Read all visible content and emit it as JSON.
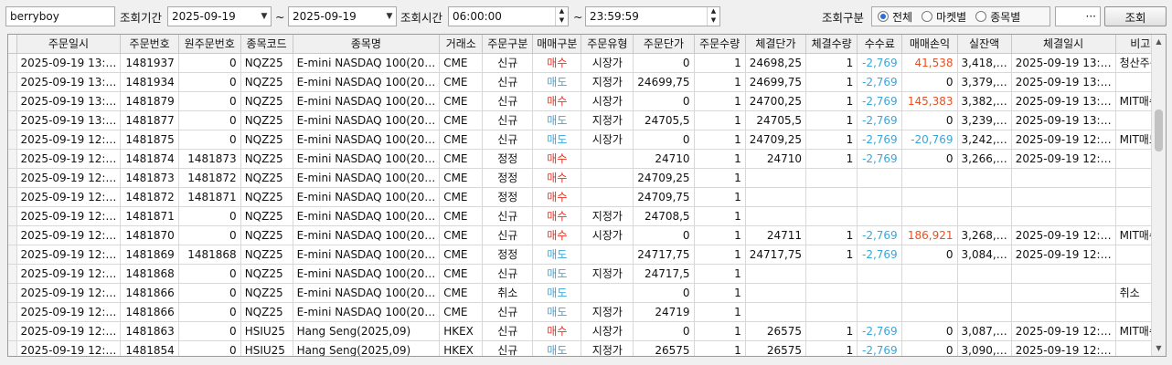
{
  "toolbar": {
    "account": "berryboy",
    "period_label": "조회기간",
    "date_from": "2025-09-19",
    "tilde": "~",
    "date_to": "2025-09-19",
    "time_label": "조회시간",
    "time_from": "06:00:00",
    "time_to": "23:59:59",
    "mode_label": "조회구분",
    "modes": [
      "전체",
      "마켓별",
      "종목별"
    ],
    "selected_mode": "전체",
    "extra_field": "",
    "ellipsis": "···",
    "search_label": "조회"
  },
  "columns": [
    "주문일시",
    "주문번호",
    "원주문번호",
    "종목코드",
    "종목명",
    "거래소",
    "주문구분",
    "매매구분",
    "주문유형",
    "주문단가",
    "주문수량",
    "체결단가",
    "체결수량",
    "수수료",
    "매매손익",
    "실잔액",
    "체결일시",
    "비고"
  ],
  "rows": [
    [
      "2025-09-19 13:…",
      "1481937",
      "0",
      "NQZ25",
      "E-mini NASDAQ 100(20…",
      "CME",
      "신규",
      "매수",
      "시장가",
      "0",
      "1",
      "24698,25",
      "1",
      "-2,769",
      "41,538",
      "3,418,…",
      "2025-09-19 13:…",
      "청산주문"
    ],
    [
      "2025-09-19 13:…",
      "1481934",
      "0",
      "NQZ25",
      "E-mini NASDAQ 100(20…",
      "CME",
      "신규",
      "매도",
      "지정가",
      "24699,75",
      "1",
      "24699,75",
      "1",
      "-2,769",
      "0",
      "3,379,…",
      "2025-09-19 13:…",
      ""
    ],
    [
      "2025-09-19 13:…",
      "1481879",
      "0",
      "NQZ25",
      "E-mini NASDAQ 100(20…",
      "CME",
      "신규",
      "매수",
      "시장가",
      "0",
      "1",
      "24700,25",
      "1",
      "-2,769",
      "145,383",
      "3,382,…",
      "2025-09-19 13:…",
      "MIT매수"
    ],
    [
      "2025-09-19 13:…",
      "1481877",
      "0",
      "NQZ25",
      "E-mini NASDAQ 100(20…",
      "CME",
      "신규",
      "매도",
      "지정가",
      "24705,5",
      "1",
      "24705,5",
      "1",
      "-2,769",
      "0",
      "3,239,…",
      "2025-09-19 13:…",
      ""
    ],
    [
      "2025-09-19 12:…",
      "1481875",
      "0",
      "NQZ25",
      "E-mini NASDAQ 100(20…",
      "CME",
      "신규",
      "매도",
      "시장가",
      "0",
      "1",
      "24709,25",
      "1",
      "-2,769",
      "-20,769",
      "3,242,…",
      "2025-09-19 12:…",
      "MIT매도"
    ],
    [
      "2025-09-19 12:…",
      "1481874",
      "1481873",
      "NQZ25",
      "E-mini NASDAQ 100(20…",
      "CME",
      "정정",
      "매수",
      "",
      "24710",
      "1",
      "24710",
      "1",
      "-2,769",
      "0",
      "3,266,…",
      "2025-09-19 12:…",
      ""
    ],
    [
      "2025-09-19 12:…",
      "1481873",
      "1481872",
      "NQZ25",
      "E-mini NASDAQ 100(20…",
      "CME",
      "정정",
      "매수",
      "",
      "24709,25",
      "1",
      "",
      "",
      "",
      "",
      "",
      "",
      ""
    ],
    [
      "2025-09-19 12:…",
      "1481872",
      "1481871",
      "NQZ25",
      "E-mini NASDAQ 100(20…",
      "CME",
      "정정",
      "매수",
      "",
      "24709,75",
      "1",
      "",
      "",
      "",
      "",
      "",
      "",
      ""
    ],
    [
      "2025-09-19 12:…",
      "1481871",
      "0",
      "NQZ25",
      "E-mini NASDAQ 100(20…",
      "CME",
      "신규",
      "매수",
      "지정가",
      "24708,5",
      "1",
      "",
      "",
      "",
      "",
      "",
      "",
      ""
    ],
    [
      "2025-09-19 12:…",
      "1481870",
      "0",
      "NQZ25",
      "E-mini NASDAQ 100(20…",
      "CME",
      "신규",
      "매수",
      "시장가",
      "0",
      "1",
      "24711",
      "1",
      "-2,769",
      "186,921",
      "3,268,…",
      "2025-09-19 12:…",
      "MIT매수"
    ],
    [
      "2025-09-19 12:…",
      "1481869",
      "1481868",
      "NQZ25",
      "E-mini NASDAQ 100(20…",
      "CME",
      "정정",
      "매도",
      "",
      "24717,75",
      "1",
      "24717,75",
      "1",
      "-2,769",
      "0",
      "3,084,…",
      "2025-09-19 12:…",
      ""
    ],
    [
      "2025-09-19 12:…",
      "1481868",
      "0",
      "NQZ25",
      "E-mini NASDAQ 100(20…",
      "CME",
      "신규",
      "매도",
      "지정가",
      "24717,5",
      "1",
      "",
      "",
      "",
      "",
      "",
      "",
      ""
    ],
    [
      "2025-09-19 12:…",
      "1481866",
      "0",
      "NQZ25",
      "E-mini NASDAQ 100(20…",
      "CME",
      "취소",
      "매도",
      "",
      "0",
      "1",
      "",
      "",
      "",
      "",
      "",
      "",
      "취소"
    ],
    [
      "2025-09-19 12:…",
      "1481866",
      "0",
      "NQZ25",
      "E-mini NASDAQ 100(20…",
      "CME",
      "신규",
      "매도",
      "지정가",
      "24719",
      "1",
      "",
      "",
      "",
      "",
      "",
      "",
      ""
    ],
    [
      "2025-09-19 12:…",
      "1481863",
      "0",
      "HSIU25",
      "Hang Seng(2025,09)",
      "HKEX",
      "신규",
      "매수",
      "시장가",
      "0",
      "1",
      "26575",
      "1",
      "-2,769",
      "0",
      "3,087,…",
      "2025-09-19 12:…",
      "MIT매수"
    ],
    [
      "2025-09-19 12:…",
      "1481854",
      "0",
      "HSIU25",
      "Hang Seng(2025,09)",
      "HKEX",
      "신규",
      "매도",
      "지정가",
      "26575",
      "1",
      "26575",
      "1",
      "-2,769",
      "0",
      "3,090,…",
      "2025-09-19 12:…",
      ""
    ]
  ]
}
